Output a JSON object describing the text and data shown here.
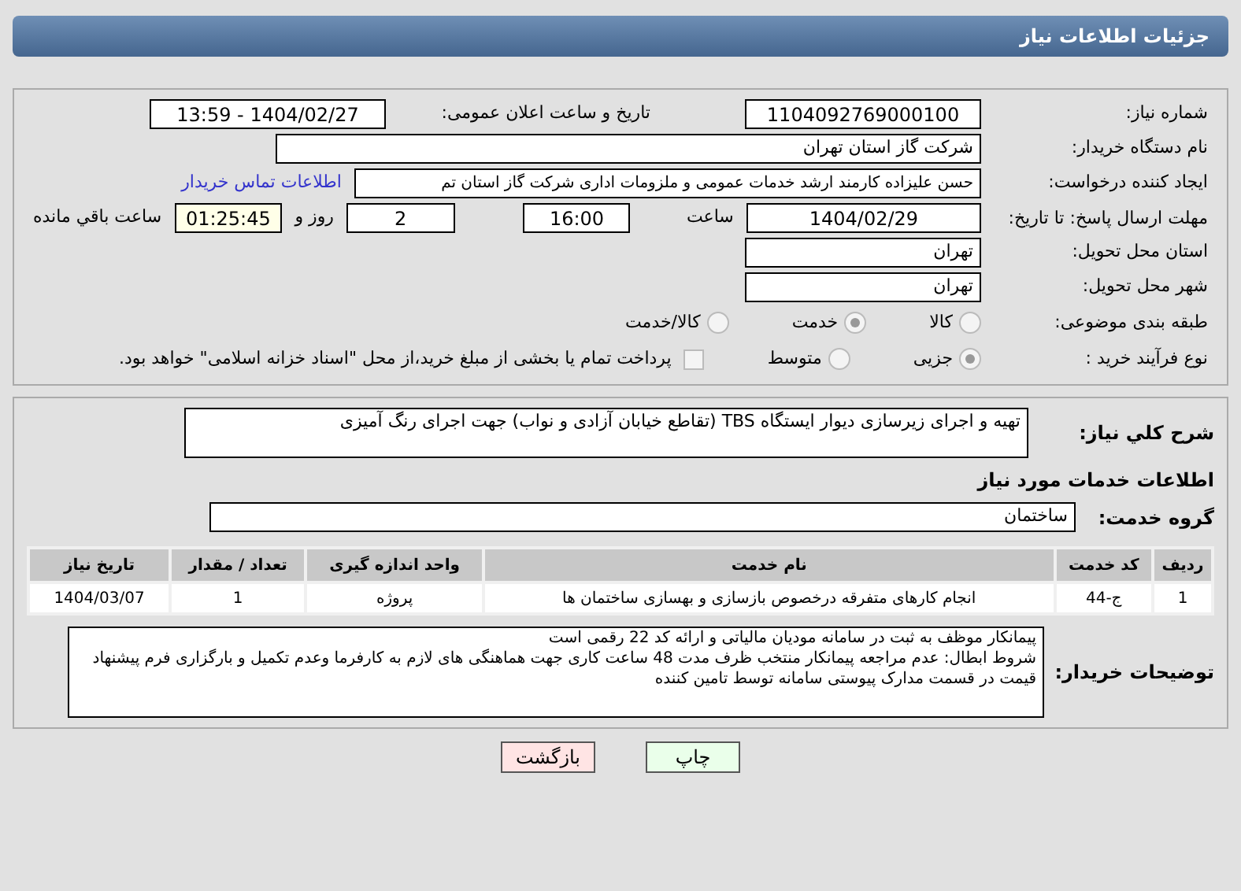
{
  "header": {
    "title": "جزئیات اطلاعات نیاز"
  },
  "info": {
    "need_number": {
      "label": "شماره نیاز:",
      "value": "1104092769000100"
    },
    "announce": {
      "label": "تاریخ و ساعت اعلان عمومی:",
      "value": "1404/02/27 - 13:59"
    },
    "buyer": {
      "label": "نام دستگاه خریدار:",
      "value": "شرکت گاز استان تهران"
    },
    "creator": {
      "label": "ایجاد کننده درخواست:",
      "value": "حسن علیزاده کارمند ارشد خدمات عمومی و ملزومات اداری شرکت گاز استان تم",
      "link": "اطلاعات تماس خریدار"
    },
    "deadline": {
      "label": "مهلت ارسال پاسخ: تا تاریخ:",
      "date": "1404/02/29",
      "time_label": "ساعت",
      "time": "16:00",
      "days": "2",
      "days_label": "روز و",
      "remaining": "01:25:45",
      "remaining_label": "ساعت باقي مانده"
    },
    "province": {
      "label": "استان محل تحویل:",
      "value": "تهران"
    },
    "city": {
      "label": "شهر محل تحویل:",
      "value": "تهران"
    },
    "category": {
      "label": "طبقه بندی موضوعی:",
      "options": [
        {
          "label": "کالا",
          "selected": false
        },
        {
          "label": "خدمت",
          "selected": true
        },
        {
          "label": "کالا/خدمت",
          "selected": false
        }
      ]
    },
    "process": {
      "label": "نوع فرآیند خرید :",
      "options": [
        {
          "label": "جزیی",
          "selected": true
        },
        {
          "label": "متوسط",
          "selected": false
        }
      ],
      "payment": {
        "checked": false,
        "label": "پرداخت تمام یا بخشی از مبلغ خرید،از محل \"اسناد خزانه اسلامی\" خواهد بود."
      }
    }
  },
  "details": {
    "description": {
      "label": "شرح کلي نياز:",
      "value": "تهیه و اجرای زیرسازی دیوار ایستگاه TBS (تقاطع خیابان آزادی و نواب) جهت اجرای رنگ آمیزی"
    },
    "section_title": "اطلاعات خدمات مورد نیاز",
    "service_group": {
      "label": "گروه خدمت:",
      "value": "ساختمان"
    },
    "table": {
      "columns": [
        "ردیف",
        "کد خدمت",
        "نام خدمت",
        "واحد اندازه گیری",
        "تعداد / مقدار",
        "تاریخ نیاز"
      ],
      "rows": [
        [
          "1",
          "ج-44",
          "انجام کارهای متفرقه درخصوص بازسازی و بهسازی ساختمان ها",
          "پروژه",
          "1",
          "1404/03/07"
        ]
      ]
    },
    "buyer_notes": {
      "label": "توضیحات خریدار:",
      "value": "پیمانکار موظف به ثبت در سامانه مودیان مالیاتی و ارائه کد 22 رقمی است\nشروط ابطال: عدم مراجعه پیمانکار منتخب ظرف مدت 48 ساعت کاری جهت هماهنگی های لازم به کارفرما وعدم تکمیل و بارگزاری فرم پیشنهاد قیمت در قسمت مدارک پیوستی سامانه توسط تامین کننده"
    }
  },
  "buttons": [
    {
      "kind": "print",
      "label": "چاپ"
    },
    {
      "kind": "back",
      "label": "بازگشت"
    }
  ]
}
